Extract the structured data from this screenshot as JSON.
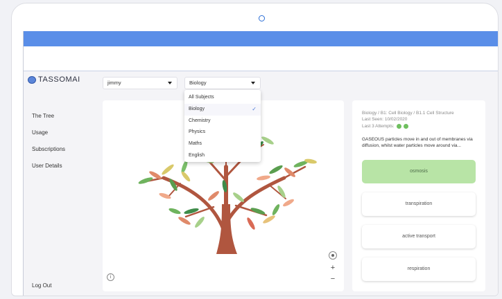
{
  "app": {
    "logo_text": "TASSOMAI"
  },
  "sidebar": {
    "items": [
      {
        "label": "The Tree"
      },
      {
        "label": "Usage"
      },
      {
        "label": "Subscriptions"
      },
      {
        "label": "User Details"
      }
    ],
    "logout_label": "Log Out"
  },
  "filters": {
    "user_select": {
      "value": "jimmy"
    },
    "subject_select": {
      "value": "Biology",
      "options": [
        "All Subjects",
        "Biology",
        "Chemistry",
        "Physics",
        "Maths",
        "English"
      ]
    }
  },
  "tree_controls": {
    "info": "i",
    "zoom_in": "+",
    "zoom_out": "−"
  },
  "question_panel": {
    "breadcrumb": "Biology / B1: Cell Biology / B1.1 Cell Structure",
    "last_seen": "Last Seen: 10/02/2020",
    "last_attempts_label": "Last 3 Attempts:",
    "question": "GASEOUS particles move in and out of membranes via diffusion, whilst water particles move around via...",
    "answers": [
      {
        "label": "osmosis",
        "state": "correct"
      },
      {
        "label": "transpiration"
      },
      {
        "label": "active transport"
      },
      {
        "label": "respiration"
      }
    ]
  },
  "colors": {
    "accent": "#5a8ee8",
    "correct": "#b8e4a6",
    "trunk": "#b0563f",
    "attempt_dot": "#6fbf5f"
  }
}
